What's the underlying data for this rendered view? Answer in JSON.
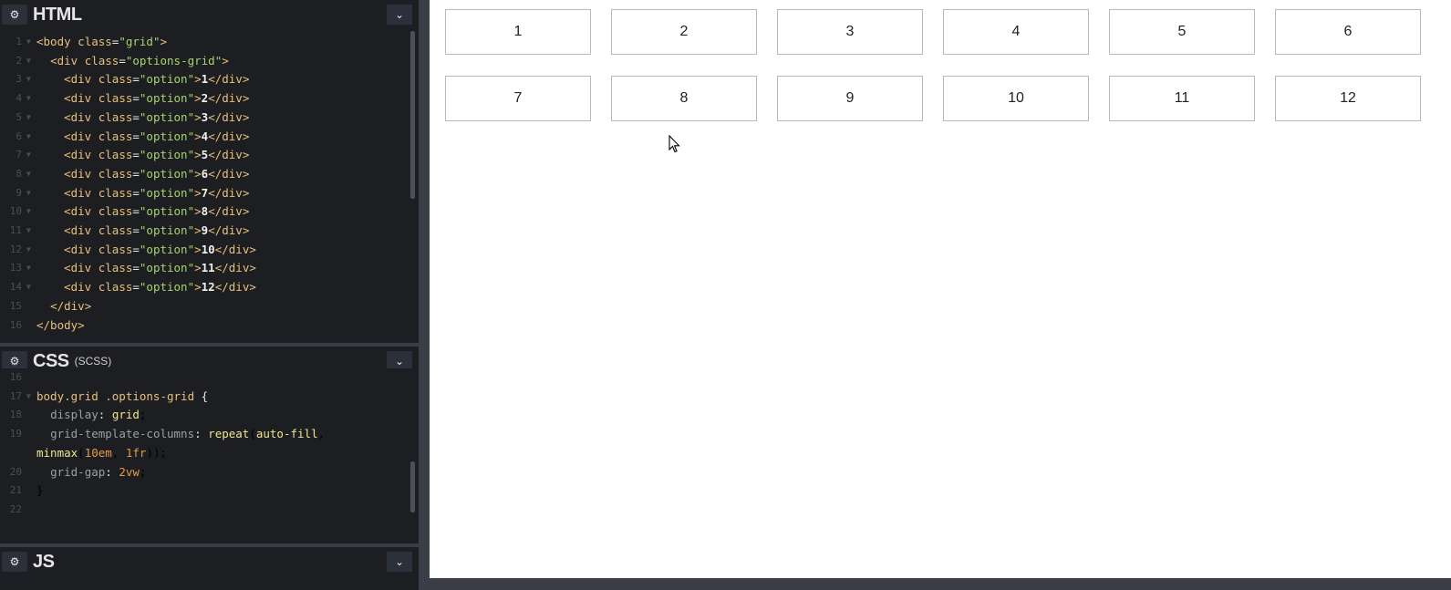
{
  "panels": {
    "html": {
      "title": "HTML"
    },
    "css": {
      "title": "CSS",
      "subtitle": "(SCSS)"
    },
    "js": {
      "title": "JS"
    }
  },
  "icons": {
    "settings": "gear-icon",
    "collapse": "chevron-down-icon",
    "cursor": "mouse-pointer-icon"
  },
  "html_code": [
    {
      "n": "1",
      "t": "<body class=\"grid\">"
    },
    {
      "n": "2",
      "t": "  <div class=\"options-grid\">"
    },
    {
      "n": "3",
      "t": "    <div class=\"option\">1</div>"
    },
    {
      "n": "4",
      "t": "    <div class=\"option\">2</div>"
    },
    {
      "n": "5",
      "t": "    <div class=\"option\">3</div>"
    },
    {
      "n": "6",
      "t": "    <div class=\"option\">4</div>"
    },
    {
      "n": "7",
      "t": "    <div class=\"option\">5</div>"
    },
    {
      "n": "8",
      "t": "    <div class=\"option\">6</div>"
    },
    {
      "n": "9",
      "t": "    <div class=\"option\">7</div>"
    },
    {
      "n": "10",
      "t": "    <div class=\"option\">8</div>"
    },
    {
      "n": "11",
      "t": "    <div class=\"option\">9</div>"
    },
    {
      "n": "12",
      "t": "    <div class=\"option\">10</div>"
    },
    {
      "n": "13",
      "t": "    <div class=\"option\">11</div>"
    },
    {
      "n": "14",
      "t": "    <div class=\"option\">12</div>"
    },
    {
      "n": "15",
      "t": "  </div>"
    },
    {
      "n": "16",
      "t": "</body>"
    }
  ],
  "css_code": [
    {
      "n": "16",
      "t": ""
    },
    {
      "n": "17",
      "t": "body.grid .options-grid {"
    },
    {
      "n": "18",
      "t": "  display: grid;"
    },
    {
      "n": "19",
      "t": "  grid-template-columns: repeat(auto-fill,"
    },
    {
      "n": "",
      "t": "minmax(10em, 1fr));"
    },
    {
      "n": "20",
      "t": "  grid-gap: 2vw;"
    },
    {
      "n": "21",
      "t": "}"
    },
    {
      "n": "22",
      "t": ""
    }
  ],
  "preview": {
    "options": [
      "1",
      "2",
      "3",
      "4",
      "5",
      "6",
      "7",
      "8",
      "9",
      "10",
      "11",
      "12"
    ]
  }
}
